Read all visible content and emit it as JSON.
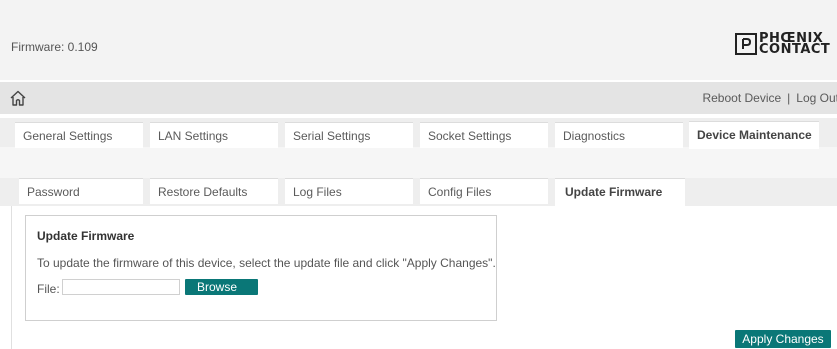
{
  "header": {
    "firmware_label": "Firmware: 0.109",
    "logo": {
      "line1": "PHŒNIX",
      "line2": "CONTACT"
    }
  },
  "navbar": {
    "home_icon": "home-icon",
    "reboot_label": "Reboot Device",
    "separator": "|",
    "logout_label": "Log Out"
  },
  "main_tabs": [
    {
      "label": "General Settings",
      "active": false
    },
    {
      "label": "LAN Settings",
      "active": false
    },
    {
      "label": "Serial Settings",
      "active": false
    },
    {
      "label": "Socket Settings",
      "active": false
    },
    {
      "label": "Diagnostics",
      "active": false
    },
    {
      "label": "Device Maintenance",
      "active": true
    }
  ],
  "sub_tabs": [
    {
      "label": "Password",
      "active": false
    },
    {
      "label": "Restore Defaults",
      "active": false
    },
    {
      "label": "Log Files",
      "active": false
    },
    {
      "label": "Config Files",
      "active": false
    },
    {
      "label": "Update Firmware",
      "active": true
    }
  ],
  "update": {
    "title": "Update Firmware",
    "description": "To update the firmware of this device, select the update file and click \"Apply Changes\".",
    "file_label": "File:",
    "file_value": "",
    "browse_label": "Browse"
  },
  "apply_label": "Apply Changes",
  "colors": {
    "accent": "#0a7777",
    "header_bg": "#f3f3f3",
    "navbar_bg": "#e4e4e4"
  }
}
